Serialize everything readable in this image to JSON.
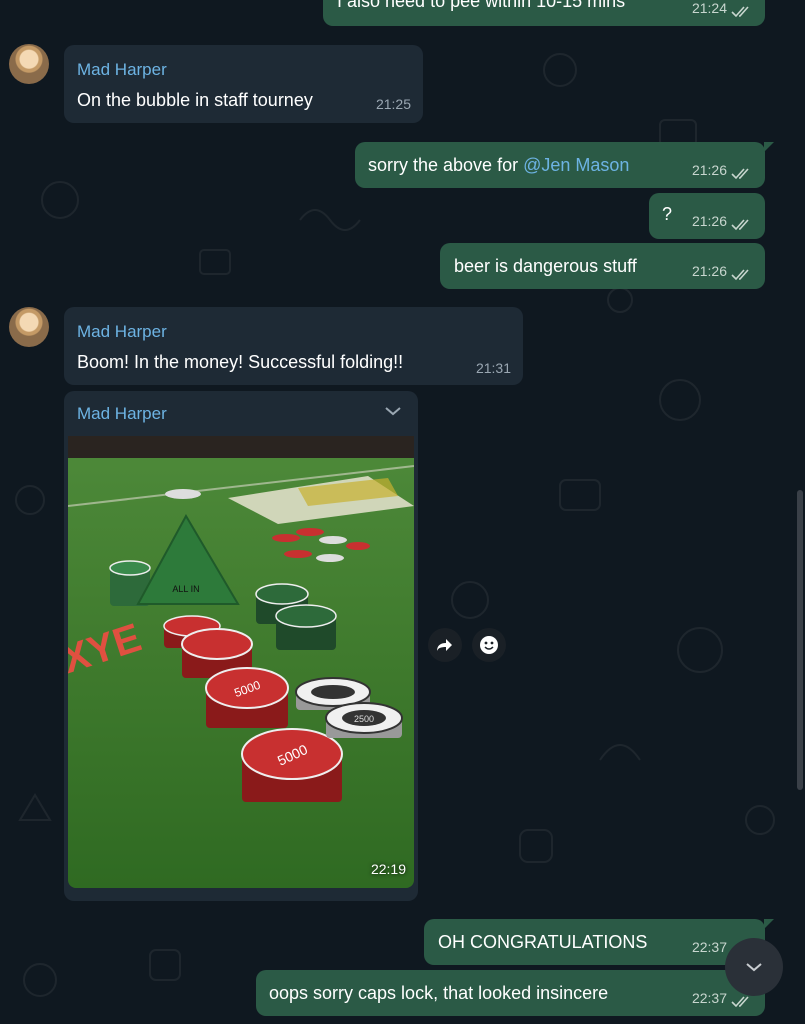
{
  "messages": {
    "m1": {
      "text": "I also need to pee within 10-15 mins",
      "time": "21:24"
    },
    "m2": {
      "sender": "Mad Harper",
      "text": "On the bubble in staff tourney",
      "time": "21:25"
    },
    "m3": {
      "prefix": "sorry the above for ",
      "mention": "@Jen Mason",
      "time": "21:26"
    },
    "m4": {
      "text": "?",
      "time": "21:26"
    },
    "m5": {
      "text": "beer is dangerous stuff",
      "time": "21:26"
    },
    "m6": {
      "sender": "Mad Harper",
      "text": "Boom! In the money! Successful folding!!",
      "time": "21:31"
    },
    "m7": {
      "sender": "Mad Harper",
      "time": "22:19",
      "image_alt": "Photo of poker chips stacked on a green felt table with an ALL IN triangle marker"
    },
    "m8": {
      "text": "OH CONGRATULATIONS",
      "time": "22:37"
    },
    "m9": {
      "text": "oops sorry caps lock, that looked insincere",
      "time": "22:37"
    }
  },
  "photo": {
    "marker_text": "ALL IN",
    "chip_value": "5000",
    "chip_value_small": "2500",
    "table_text": "XYE"
  },
  "icons": [
    "forward-icon",
    "emoji-reaction-icon",
    "chevron-down-icon",
    "double-check-icon",
    "scroll-down-icon"
  ],
  "colors": {
    "background": "#0f1820",
    "outgoing_bubble": "#2b5a46",
    "incoming_bubble": "#1e2a35",
    "accent": "#6db3e3"
  }
}
